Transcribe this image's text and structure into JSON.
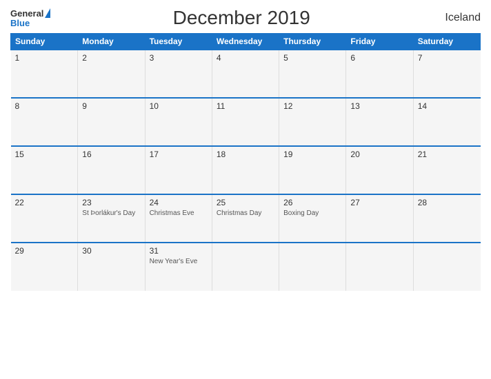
{
  "header": {
    "logo_general": "General",
    "logo_blue": "Blue",
    "title": "December 2019",
    "country": "Iceland"
  },
  "calendar": {
    "days_of_week": [
      "Sunday",
      "Monday",
      "Tuesday",
      "Wednesday",
      "Thursday",
      "Friday",
      "Saturday"
    ],
    "weeks": [
      [
        {
          "date": "1",
          "holiday": ""
        },
        {
          "date": "2",
          "holiday": ""
        },
        {
          "date": "3",
          "holiday": ""
        },
        {
          "date": "4",
          "holiday": ""
        },
        {
          "date": "5",
          "holiday": ""
        },
        {
          "date": "6",
          "holiday": ""
        },
        {
          "date": "7",
          "holiday": ""
        }
      ],
      [
        {
          "date": "8",
          "holiday": ""
        },
        {
          "date": "9",
          "holiday": ""
        },
        {
          "date": "10",
          "holiday": ""
        },
        {
          "date": "11",
          "holiday": ""
        },
        {
          "date": "12",
          "holiday": ""
        },
        {
          "date": "13",
          "holiday": ""
        },
        {
          "date": "14",
          "holiday": ""
        }
      ],
      [
        {
          "date": "15",
          "holiday": ""
        },
        {
          "date": "16",
          "holiday": ""
        },
        {
          "date": "17",
          "holiday": ""
        },
        {
          "date": "18",
          "holiday": ""
        },
        {
          "date": "19",
          "holiday": ""
        },
        {
          "date": "20",
          "holiday": ""
        },
        {
          "date": "21",
          "holiday": ""
        }
      ],
      [
        {
          "date": "22",
          "holiday": ""
        },
        {
          "date": "23",
          "holiday": "St Þorlákur's Day"
        },
        {
          "date": "24",
          "holiday": "Christmas Eve"
        },
        {
          "date": "25",
          "holiday": "Christmas Day"
        },
        {
          "date": "26",
          "holiday": "Boxing Day"
        },
        {
          "date": "27",
          "holiday": ""
        },
        {
          "date": "28",
          "holiday": ""
        }
      ],
      [
        {
          "date": "29",
          "holiday": ""
        },
        {
          "date": "30",
          "holiday": ""
        },
        {
          "date": "31",
          "holiday": "New Year's Eve"
        },
        {
          "date": "",
          "holiday": ""
        },
        {
          "date": "",
          "holiday": ""
        },
        {
          "date": "",
          "holiday": ""
        },
        {
          "date": "",
          "holiday": ""
        }
      ]
    ]
  }
}
